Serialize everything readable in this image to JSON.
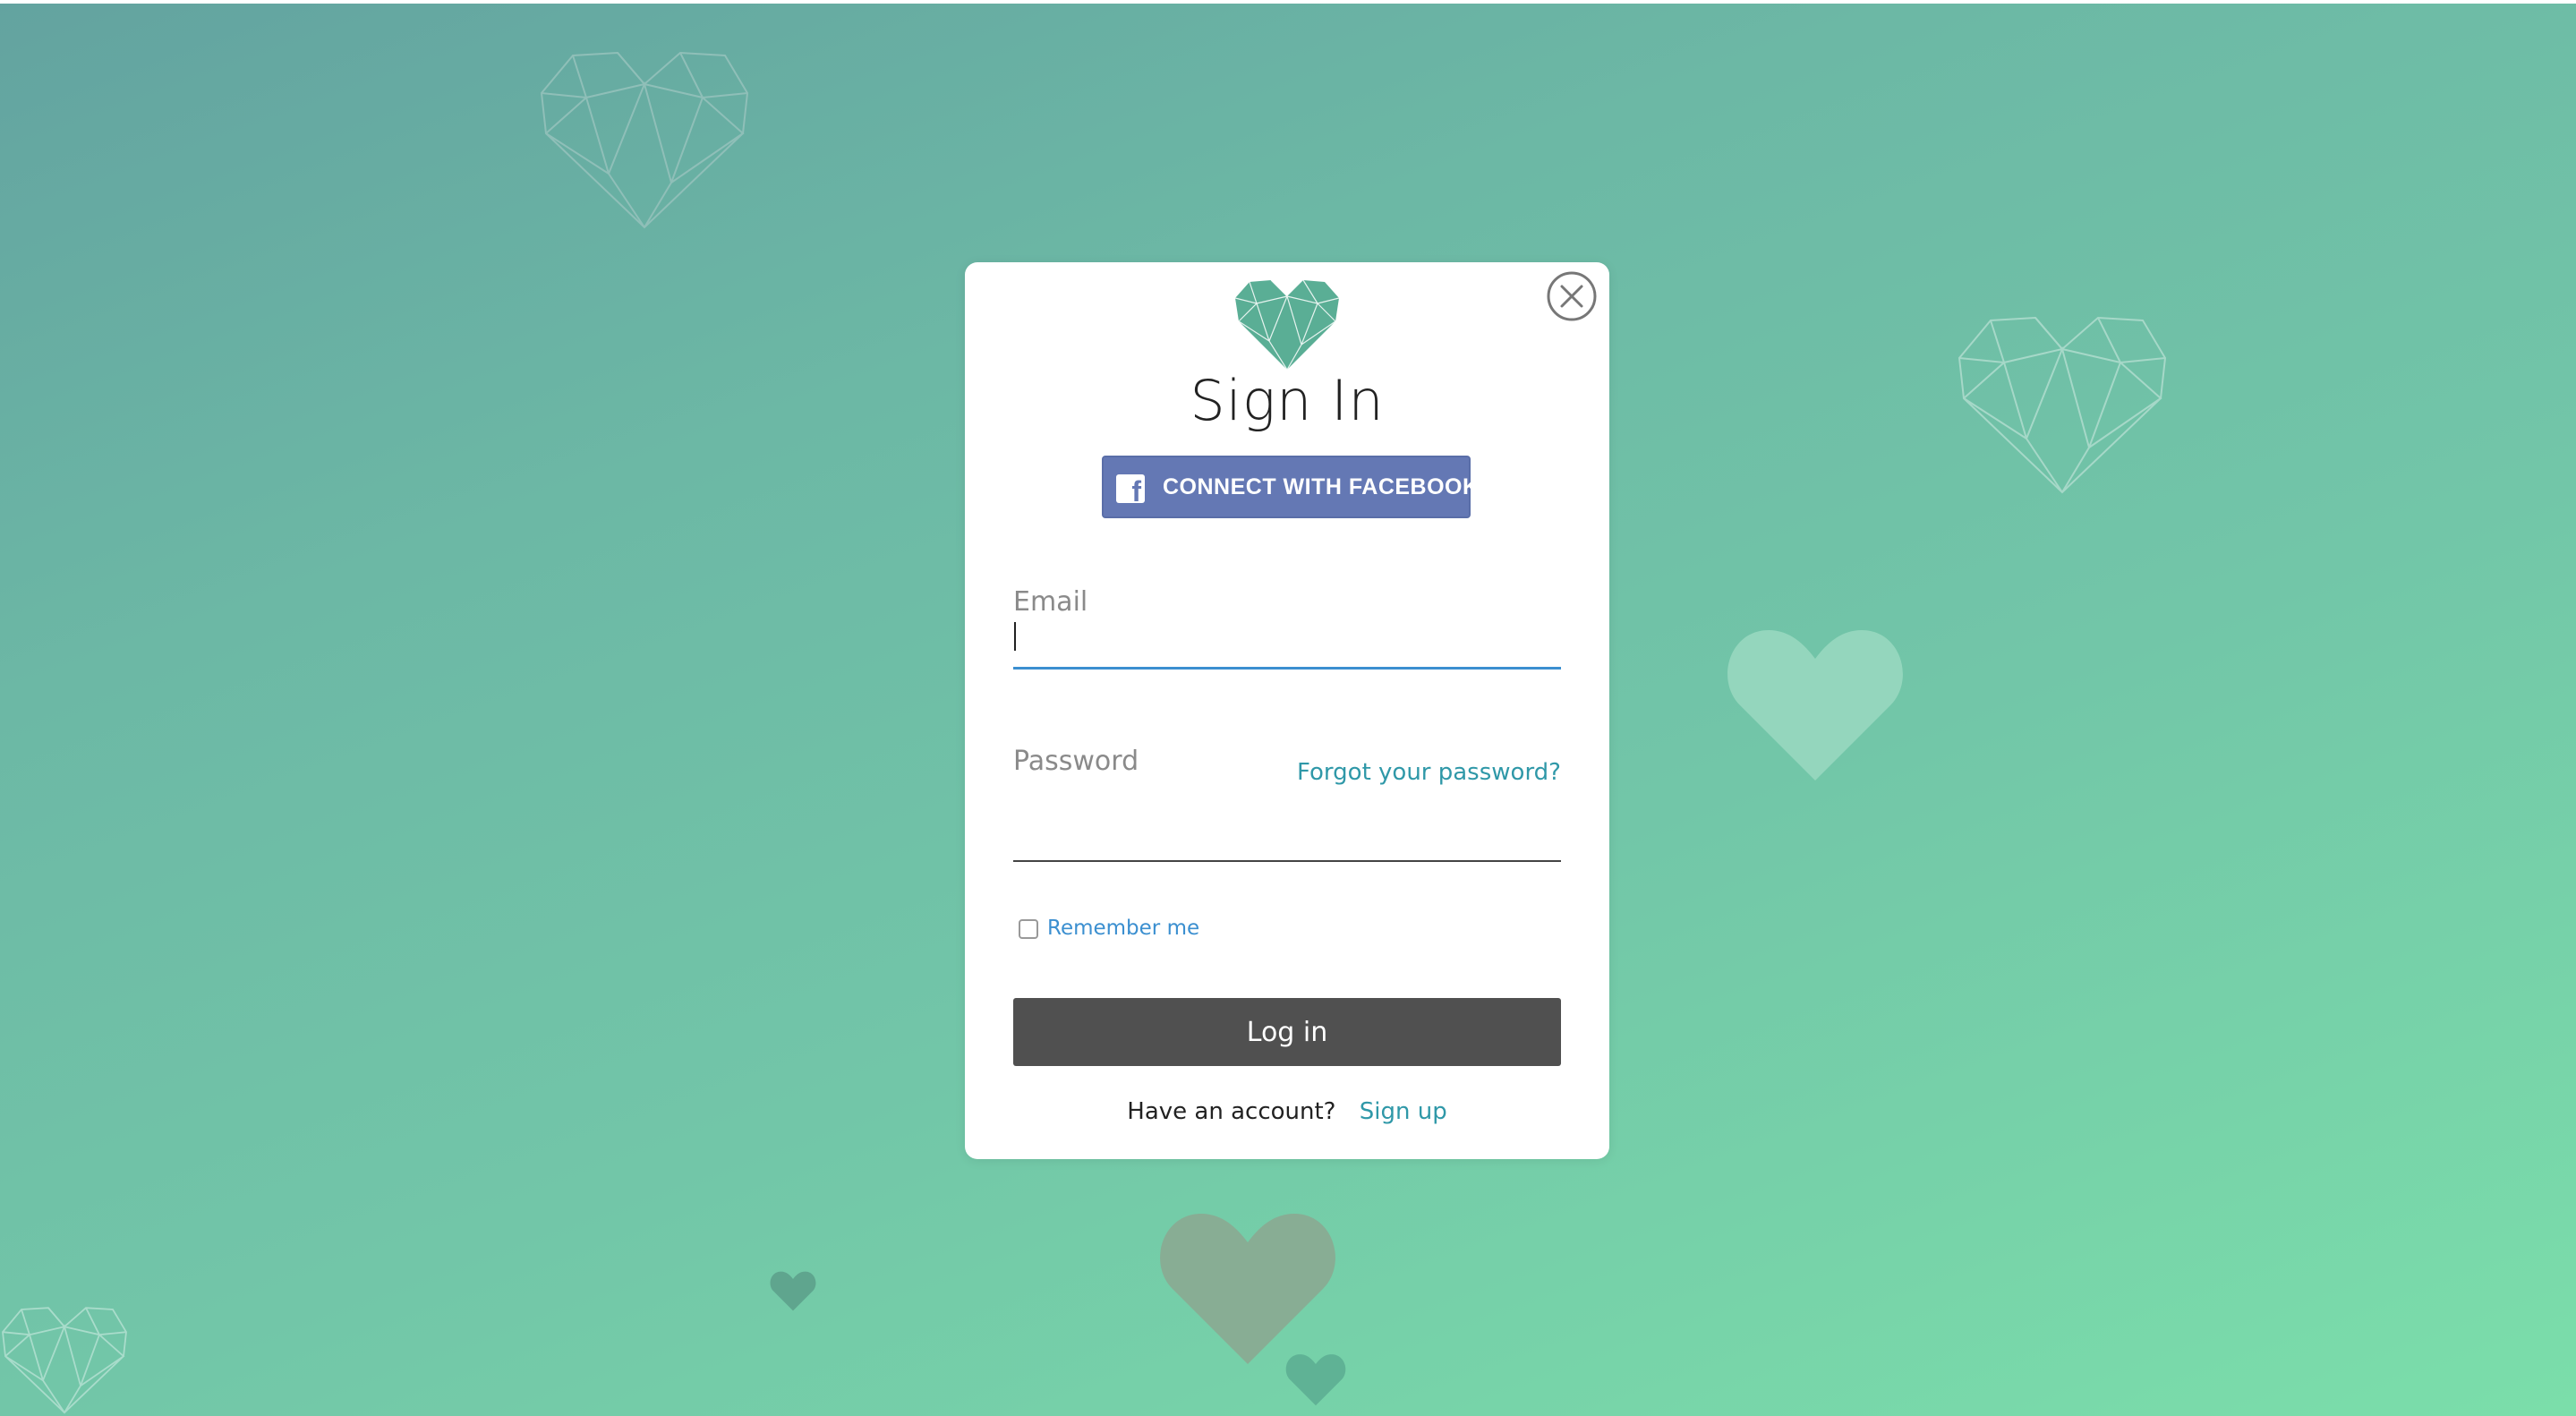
{
  "modal": {
    "title": "Sign In",
    "facebook_button_label": "CONNECT WITH FACEBOOK",
    "facebook_icon": "f",
    "email": {
      "label": "Email",
      "value": ""
    },
    "password": {
      "label": "Password",
      "value": ""
    },
    "forgot_password_link": "Forgot your password?",
    "remember_me_label": "Remember me",
    "remember_me_checked": false,
    "login_button_label": "Log in",
    "footer": {
      "question": "Have an account?",
      "signup_link": "Sign up"
    }
  },
  "colors": {
    "brand_heart": "#5aae95",
    "facebook": "#6478b4",
    "link": "#2f98a8",
    "focus_underline": "#3b8fd0",
    "login_button": "#505050"
  },
  "icons": [
    "heart-logo-icon",
    "close-icon",
    "facebook-icon"
  ]
}
